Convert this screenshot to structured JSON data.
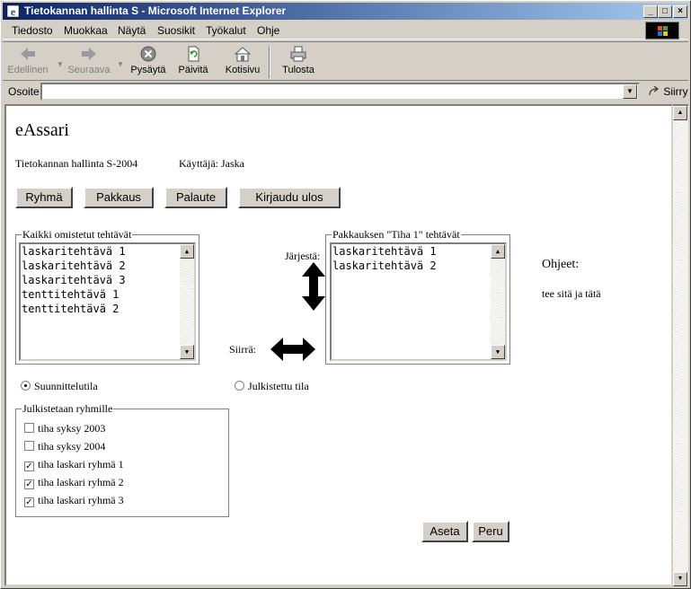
{
  "window": {
    "title": "Tietokannan hallinta S - Microsoft Internet Explorer",
    "controls": {
      "minimize": "_",
      "maximize": "□",
      "close": "×"
    }
  },
  "menu": [
    "Tiedosto",
    "Muokkaa",
    "Näytä",
    "Suosikit",
    "Työkalut",
    "Ohje"
  ],
  "toolbar": {
    "back": "Edellinen",
    "forward": "Seuraava",
    "stop": "Pysäytä",
    "refresh": "Päivitä",
    "home": "Kotisivu",
    "print": "Tulosta"
  },
  "address": {
    "label": "Osoite",
    "value": "",
    "go": "Siirry"
  },
  "page": {
    "heading": "eAssari",
    "course": "Tietokannan hallinta S-2004",
    "user": "Käyttäjä: Jaska",
    "nav": [
      "Ryhmä",
      "Pakkaus",
      "Palaute",
      "Kirjaudu ulos"
    ],
    "all_tasks": {
      "legend": "Kaikki omistetut tehtävät",
      "items": [
        "laskaritehtävä 1",
        "laskaritehtävä 2",
        "laskaritehtävä 3",
        "tenttitehtävä 1",
        "tenttitehtävä 2"
      ]
    },
    "package_tasks": {
      "legend": "Pakkauksen \"Tiha 1\" tehtävät",
      "items": [
        "laskaritehtävä 1",
        "laskaritehtävä 2"
      ]
    },
    "order_label": "Järjestä:",
    "move_label": "Siirrä:",
    "help": {
      "title": "Ohjeet:",
      "text": "tee sitä ja tätä"
    },
    "mode": {
      "design": {
        "label": "Suunnittelutila",
        "selected": true
      },
      "published": {
        "label": "Julkistettu tila",
        "selected": false
      }
    },
    "groups": {
      "legend": "Julkistetaan ryhmille",
      "items": [
        {
          "label": "tiha syksy 2003",
          "checked": false
        },
        {
          "label": "tiha syksy 2004",
          "checked": false
        },
        {
          "label": "tiha laskari ryhmä 1",
          "checked": true
        },
        {
          "label": "tiha laskari ryhmä 2",
          "checked": true
        },
        {
          "label": "tiha laskari ryhmä 3",
          "checked": true
        }
      ]
    },
    "actions": {
      "set": "Aseta",
      "cancel": "Peru"
    }
  },
  "colors": {
    "titlebar_start": "#0a246a",
    "titlebar_end": "#a6caf0",
    "chrome": "#d4d0c8"
  },
  "icons": [
    "ie-icon",
    "back-arrow-icon",
    "forward-arrow-icon",
    "stop-icon",
    "refresh-icon",
    "home-icon",
    "print-icon",
    "go-arrow-icon",
    "windows-logo-icon",
    "vertical-arrow-icon",
    "horizontal-arrow-icon"
  ]
}
